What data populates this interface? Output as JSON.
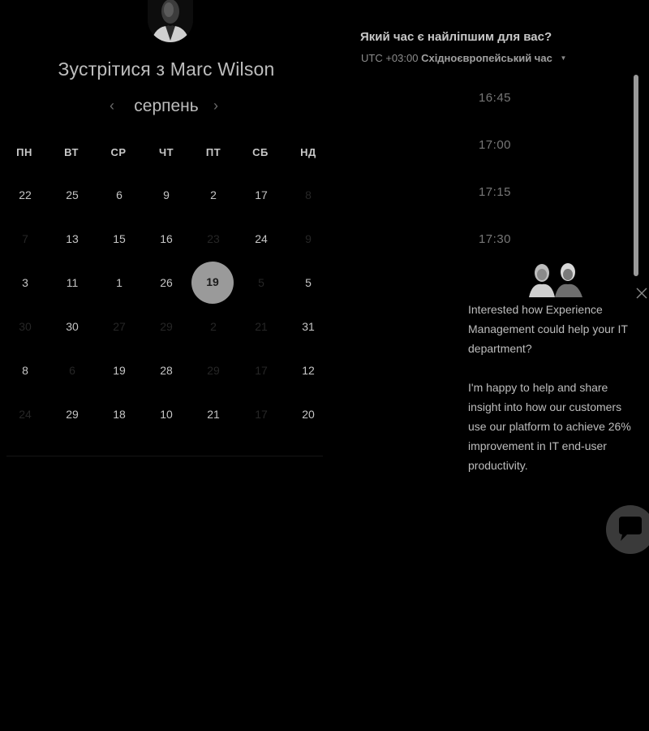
{
  "header": {
    "title": "Зустрітися з Marc Wilson"
  },
  "calendar": {
    "month": "серпень",
    "prev_icon": "‹",
    "next_icon": "›",
    "weekdays": [
      "ПН",
      "ВТ",
      "СР",
      "ЧТ",
      "ПТ",
      "СБ",
      "НД"
    ],
    "weeks": [
      [
        {
          "text": "22",
          "dim": false
        },
        {
          "text": "25",
          "dim": false
        },
        {
          "text": "6",
          "dim": false
        },
        {
          "text": "9",
          "dim": false
        },
        {
          "text": "2",
          "dim": false
        },
        {
          "text": "17",
          "dim": false
        },
        {
          "text": "8",
          "dim": true
        }
      ],
      [
        {
          "text": "7",
          "dim": true
        },
        {
          "text": "13",
          "dim": false
        },
        {
          "text": "15",
          "dim": false
        },
        {
          "text": "16",
          "dim": false
        },
        {
          "text": "23",
          "dim": true
        },
        {
          "text": "24",
          "dim": false
        },
        {
          "text": "9",
          "dim": true
        }
      ],
      [
        {
          "text": "3",
          "dim": false
        },
        {
          "text": "11",
          "dim": false
        },
        {
          "text": "1",
          "dim": false
        },
        {
          "text": "26",
          "dim": false
        },
        {
          "text": "19",
          "dim": false,
          "selected": true
        },
        {
          "text": "5",
          "dim": true
        },
        {
          "text": "5",
          "dim": false
        }
      ],
      [
        {
          "text": "30",
          "dim": true
        },
        {
          "text": "30",
          "dim": false
        },
        {
          "text": "27",
          "dim": true
        },
        {
          "text": "29",
          "dim": true
        },
        {
          "text": "2",
          "dim": true
        },
        {
          "text": "21",
          "dim": true
        },
        {
          "text": "31",
          "dim": false
        }
      ],
      [
        {
          "text": "8",
          "dim": false
        },
        {
          "text": "6",
          "dim": true
        },
        {
          "text": "19",
          "dim": false
        },
        {
          "text": "28",
          "dim": false
        },
        {
          "text": "29",
          "dim": true
        },
        {
          "text": "17",
          "dim": true
        },
        {
          "text": "12",
          "dim": false
        }
      ],
      [
        {
          "text": "24",
          "dim": true
        },
        {
          "text": "29",
          "dim": false
        },
        {
          "text": "18",
          "dim": false
        },
        {
          "text": "10",
          "dim": false
        },
        {
          "text": "21",
          "dim": false
        },
        {
          "text": "17",
          "dim": true
        },
        {
          "text": "20",
          "dim": false
        }
      ]
    ]
  },
  "time_picker": {
    "question": "Який час є найліпшим для вас?",
    "timezone_offset": "UTC +03:00",
    "timezone_name": "Східноєвропейський час",
    "slots": [
      "16:45",
      "17:00",
      "17:15",
      "17:30"
    ]
  },
  "chat": {
    "message_1": "Interested how Experience Management could help your IT department?",
    "message_2": "I'm happy to help and share insight into how our customers use our platform to achieve 26% improvement in IT end-user productivity."
  },
  "colors": {
    "background": "#000000",
    "selected_day": "#9a9a9a",
    "scrollbar": "#9a9a9a",
    "text": "#c6c6c6"
  },
  "icons": {
    "prev": "chevron-left-icon",
    "next": "chevron-right-icon",
    "timezone_caret": "caret-down-icon",
    "chat_close": "close-icon",
    "chat_launcher": "chat-bubble-icon"
  }
}
